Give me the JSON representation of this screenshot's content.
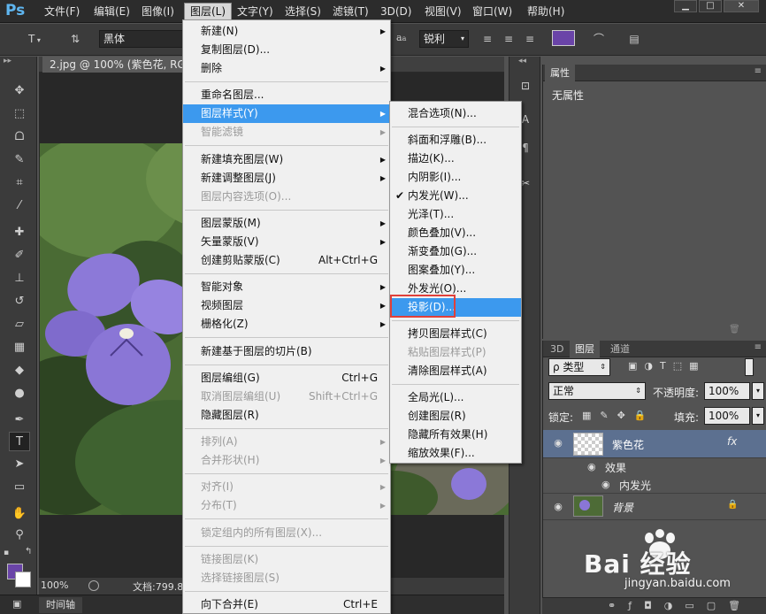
{
  "app": {
    "logo": "Ps"
  },
  "menubar": {
    "items": [
      "文件(F)",
      "编辑(E)",
      "图像(I)",
      "图层(L)",
      "文字(Y)",
      "选择(S)",
      "滤镜(T)",
      "3D(D)",
      "视图(V)",
      "窗口(W)",
      "帮助(H)"
    ],
    "active_index": 3
  },
  "window_controls": {
    "minimize": "▁",
    "maximize": "□",
    "close": "✕"
  },
  "options_bar": {
    "tool_glyph": "T",
    "font_family": "黑体",
    "antialias_prefix": "a",
    "antialias": "锐利",
    "color": "#6a44a8"
  },
  "document": {
    "tab_title": "2.jpg @ 100% (紫色花, RGB/",
    "zoom": "100%",
    "doc_info": "文档:799.8"
  },
  "timeline": {
    "label": "时间轴"
  },
  "colors": {
    "foreground": "#6a44a8",
    "background": "#ffffff",
    "menu_highlight": "#3c99ee",
    "annotation_box": "#e0403a"
  },
  "layer_menu": {
    "items": [
      {
        "label": "新建(N)",
        "submenu": true
      },
      {
        "label": "复制图层(D)..."
      },
      {
        "label": "删除",
        "submenu": true
      },
      {
        "sep": true
      },
      {
        "label": "重命名图层..."
      },
      {
        "label": "图层样式(Y)",
        "submenu": true,
        "highlighted": true
      },
      {
        "label": "智能滤镜",
        "submenu": true,
        "disabled": true
      },
      {
        "sep": true
      },
      {
        "label": "新建填充图层(W)",
        "submenu": true
      },
      {
        "label": "新建调整图层(J)",
        "submenu": true
      },
      {
        "label": "图层内容选项(O)...",
        "disabled": true
      },
      {
        "sep": true
      },
      {
        "label": "图层蒙版(M)",
        "submenu": true
      },
      {
        "label": "矢量蒙版(V)",
        "submenu": true
      },
      {
        "label": "创建剪贴蒙版(C)",
        "shortcut": "Alt+Ctrl+G"
      },
      {
        "sep": true
      },
      {
        "label": "智能对象",
        "submenu": true
      },
      {
        "label": "视频图层",
        "submenu": true
      },
      {
        "label": "栅格化(Z)",
        "submenu": true
      },
      {
        "sep": true
      },
      {
        "label": "新建基于图层的切片(B)"
      },
      {
        "sep": true
      },
      {
        "label": "图层编组(G)",
        "shortcut": "Ctrl+G"
      },
      {
        "label": "取消图层编组(U)",
        "shortcut": "Shift+Ctrl+G",
        "disabled": true
      },
      {
        "label": "隐藏图层(R)"
      },
      {
        "sep": true
      },
      {
        "label": "排列(A)",
        "submenu": true,
        "disabled": true
      },
      {
        "label": "合并形状(H)",
        "submenu": true,
        "disabled": true
      },
      {
        "sep": true
      },
      {
        "label": "对齐(I)",
        "submenu": true,
        "disabled": true
      },
      {
        "label": "分布(T)",
        "submenu": true,
        "disabled": true
      },
      {
        "sep": true
      },
      {
        "label": "锁定组内的所有图层(X)...",
        "disabled": true
      },
      {
        "sep": true
      },
      {
        "label": "链接图层(K)",
        "disabled": true
      },
      {
        "label": "选择链接图层(S)",
        "disabled": true
      },
      {
        "sep": true
      },
      {
        "label": "向下合并(E)",
        "shortcut": "Ctrl+E"
      }
    ]
  },
  "style_submenu": {
    "items": [
      {
        "label": "混合选项(N)..."
      },
      {
        "sep": true
      },
      {
        "label": "斜面和浮雕(B)..."
      },
      {
        "label": "描边(K)..."
      },
      {
        "label": "内阴影(I)..."
      },
      {
        "label": "内发光(W)...",
        "checked": true
      },
      {
        "label": "光泽(T)..."
      },
      {
        "label": "颜色叠加(V)..."
      },
      {
        "label": "渐变叠加(G)..."
      },
      {
        "label": "图案叠加(Y)..."
      },
      {
        "label": "外发光(O)..."
      },
      {
        "label": "投影(D)...",
        "highlighted": true,
        "boxed": true
      },
      {
        "sep": true
      },
      {
        "label": "拷贝图层样式(C)"
      },
      {
        "label": "粘贴图层样式(P)",
        "disabled": true
      },
      {
        "label": "清除图层样式(A)"
      },
      {
        "sep": true
      },
      {
        "label": "全局光(L)..."
      },
      {
        "label": "创建图层(R)"
      },
      {
        "label": "隐藏所有效果(H)"
      },
      {
        "label": "缩放效果(F)..."
      }
    ]
  },
  "properties_panel": {
    "tab": "属性",
    "empty_text": "无属性"
  },
  "layers_panel": {
    "tabs": [
      "3D",
      "图层",
      "通道"
    ],
    "active_tab": 1,
    "filter_label": "ρ 类型",
    "blend_mode": "正常",
    "opacity_label": "不透明度:",
    "opacity_value": "100%",
    "lock_label": "锁定:",
    "fill_label": "填充:",
    "fill_value": "100%",
    "layers": [
      {
        "name": "紫色花",
        "fx": "fx"
      },
      {
        "effects_label": "效果",
        "effect": "内发光"
      },
      {
        "name": "背景",
        "locked": true
      }
    ]
  },
  "watermark": {
    "brand": "Bai 经验",
    "url": "jingyan.baidu.com"
  }
}
